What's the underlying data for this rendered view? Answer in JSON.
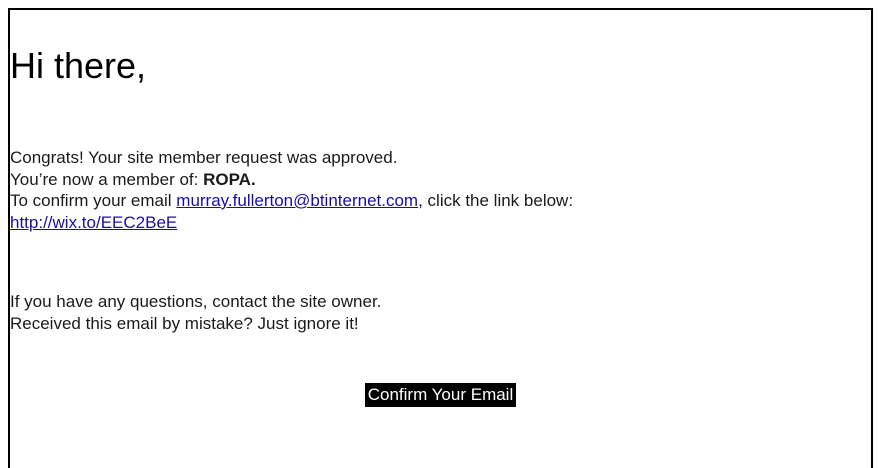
{
  "email": {
    "greeting": "Hi there,",
    "line1": "Congrats! Your site member request was approved.",
    "line2_prefix": "You’re now a member of: ",
    "site_name": "ROPA.",
    "line3_prefix": "To confirm your email ",
    "email_address": "murray.fullerton@btinternet.com",
    "line3_suffix": ", click the link below:",
    "confirm_link": "http://wix.to/EEC2BeE",
    "help_line1": "If you have any questions, contact the site owner.",
    "help_line2": "Received this email by mistake? Just ignore it!",
    "cta_label": "Confirm Your Email"
  }
}
